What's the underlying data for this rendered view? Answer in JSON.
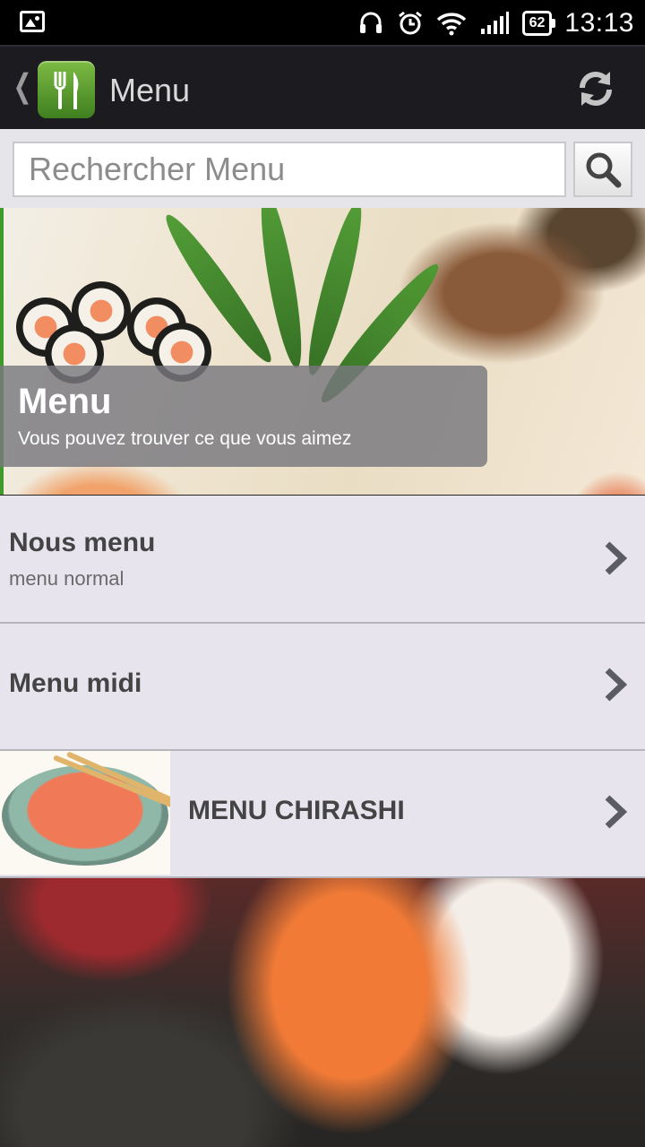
{
  "status_bar": {
    "battery": "62",
    "time": "13:13"
  },
  "action_bar": {
    "title": "Menu"
  },
  "search": {
    "placeholder": "Rechercher Menu",
    "value": ""
  },
  "hero": {
    "title": "Menu",
    "subtitle": "Vous pouvez trouver ce que vous aimez"
  },
  "menu_items": [
    {
      "title": "Nous menu",
      "subtitle": "menu normal"
    },
    {
      "title": "Menu midi"
    },
    {
      "title": "MENU CHIRASHI"
    }
  ],
  "colors": {
    "status_bar_bg": "#000000",
    "action_bar_bg": "#1c1b20",
    "list_bg": "#e7e4ee",
    "list_divider": "#b7b5bc",
    "brand_green": "#5a9e2f",
    "text_dark": "#444444"
  },
  "icons": {
    "status_left": "image-notification-icon",
    "status_right": [
      "headset-icon",
      "alarm-icon",
      "wifi-icon",
      "signal-icon",
      "battery-icon"
    ],
    "app": "fork-knife-icon",
    "refresh": "refresh-icon",
    "search": "search-icon",
    "row_arrow": "chevron-right-icon"
  }
}
